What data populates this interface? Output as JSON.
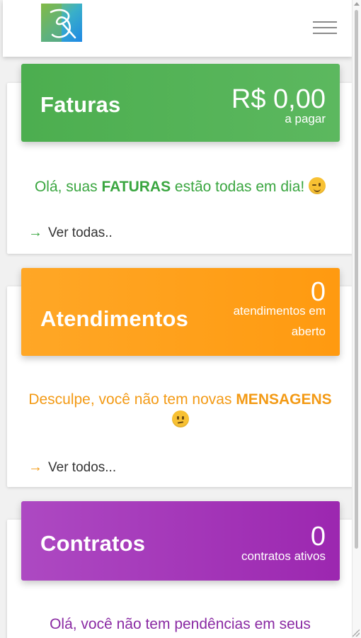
{
  "header": {
    "logo_icon": "logo-icon",
    "menu_icon": "hamburger-menu-icon"
  },
  "colors": {
    "green": "#4caf50",
    "orange": "#ff9f1a",
    "purple": "#9c27b0",
    "green_text": "#3aa640",
    "orange_text": "#f39a15",
    "purple_text": "#8a2aa3"
  },
  "cards": {
    "faturas": {
      "title": "Faturas",
      "value": "R$ 0,00",
      "subtitle": "a pagar",
      "message_pre": "Olá, suas ",
      "message_bold": "FATURAS",
      "message_post": " estão todas em dia!",
      "emoji": "winking-face-icon",
      "link": "Ver todas.."
    },
    "atendimentos": {
      "title": "Atendimentos",
      "value": "0",
      "subtitle_line1": "atendimentos em",
      "subtitle_line2": "aberto",
      "message_pre": "Desculpe, você não tem novas ",
      "message_bold": "MENSAGENS",
      "emoji": "confused-face-icon",
      "link": "Ver todos..."
    },
    "contratos": {
      "title": "Contratos",
      "value": "0",
      "subtitle": "contratos ativos",
      "message": "Olá, você não tem pendências em seus"
    }
  }
}
